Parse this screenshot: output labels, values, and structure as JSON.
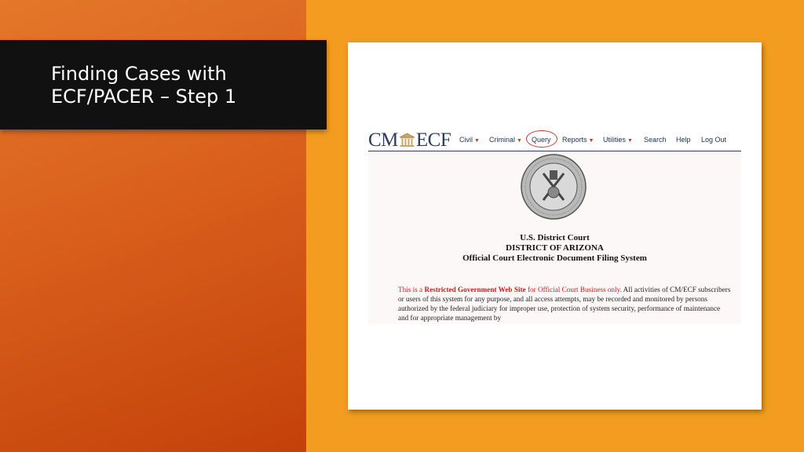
{
  "slide": {
    "title_line1": "Finding Cases with",
    "title_line2": "ECF/PACER – Step 1"
  },
  "ecf": {
    "logo_left": "CM",
    "logo_icon": "courthouse-icon",
    "logo_right": "ECF",
    "nav": [
      {
        "label": "Civil",
        "dropdown": true
      },
      {
        "label": "Criminal",
        "dropdown": true
      },
      {
        "label": "Query",
        "dropdown": false,
        "highlighted": true
      },
      {
        "label": "Reports",
        "dropdown": true
      },
      {
        "label": "Utilities",
        "dropdown": true
      },
      {
        "label": "Search",
        "dropdown": false
      },
      {
        "label": "Help",
        "dropdown": false
      },
      {
        "label": "Log Out",
        "dropdown": false
      }
    ],
    "seal_text": "ADMINISTRATIVE OFFICE OF THE UNITED STATES COURTS",
    "court_line1": "U.S. District Court",
    "court_line2": "DISTRICT OF ARIZONA",
    "court_line3": "Official Court Electronic Document Filing System",
    "notice_part1": "This is a ",
    "notice_bold": "Restricted Government Web Site",
    "notice_part2": " for Official Court Business only.",
    "notice_part3": " All activities of CM/ECF subscribers or users of this system for any purpose, and all access attempts, may be recorded and monitored by persons authorized by the federal judiciary for improper use, protection of system security, performance of maintenance and for appropriate management by"
  },
  "colors": {
    "background_orange": "#f39c1f",
    "left_gradient": "#d9601c",
    "title_box": "#111111",
    "ecf_navy": "#2b3d63",
    "highlight_red": "#c0392b"
  }
}
